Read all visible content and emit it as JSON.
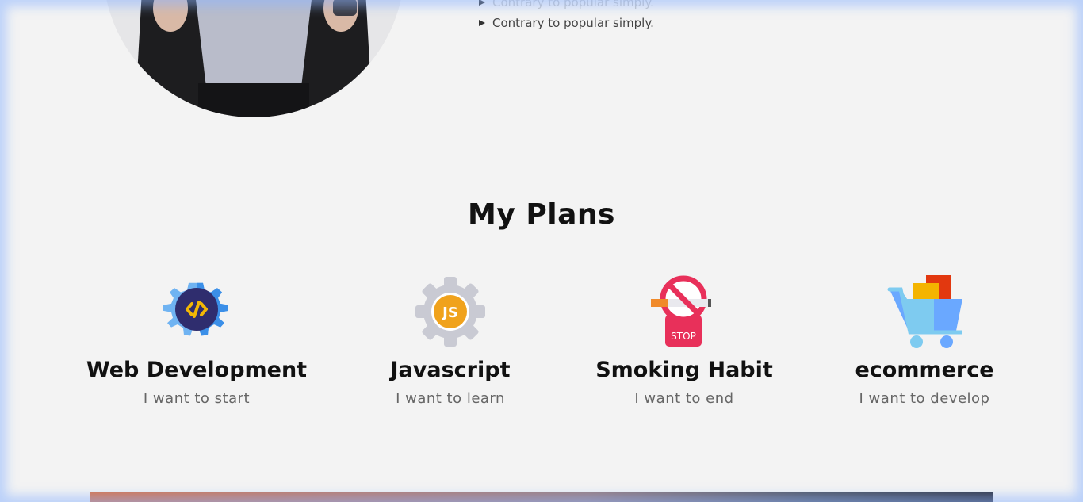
{
  "hero": {
    "bullets": [
      "Contrary to popular simply."
    ]
  },
  "plans": {
    "title": "My Plans",
    "items": [
      {
        "name": "Web Development",
        "desc": "I want to start",
        "icon": "web-development-icon"
      },
      {
        "name": "Javascript",
        "desc": "I want to learn",
        "icon": "javascript-icon"
      },
      {
        "name": "Smoking Habit",
        "desc": "I want to end",
        "icon": "no-smoking-icon",
        "icon_text": "STOP"
      },
      {
        "name": "ecommerce",
        "desc": "I want to develop",
        "icon": "shopping-cart-icon"
      }
    ]
  },
  "colors": {
    "background": "#f3f3f3",
    "heading": "#111111",
    "subtext": "#666666"
  }
}
